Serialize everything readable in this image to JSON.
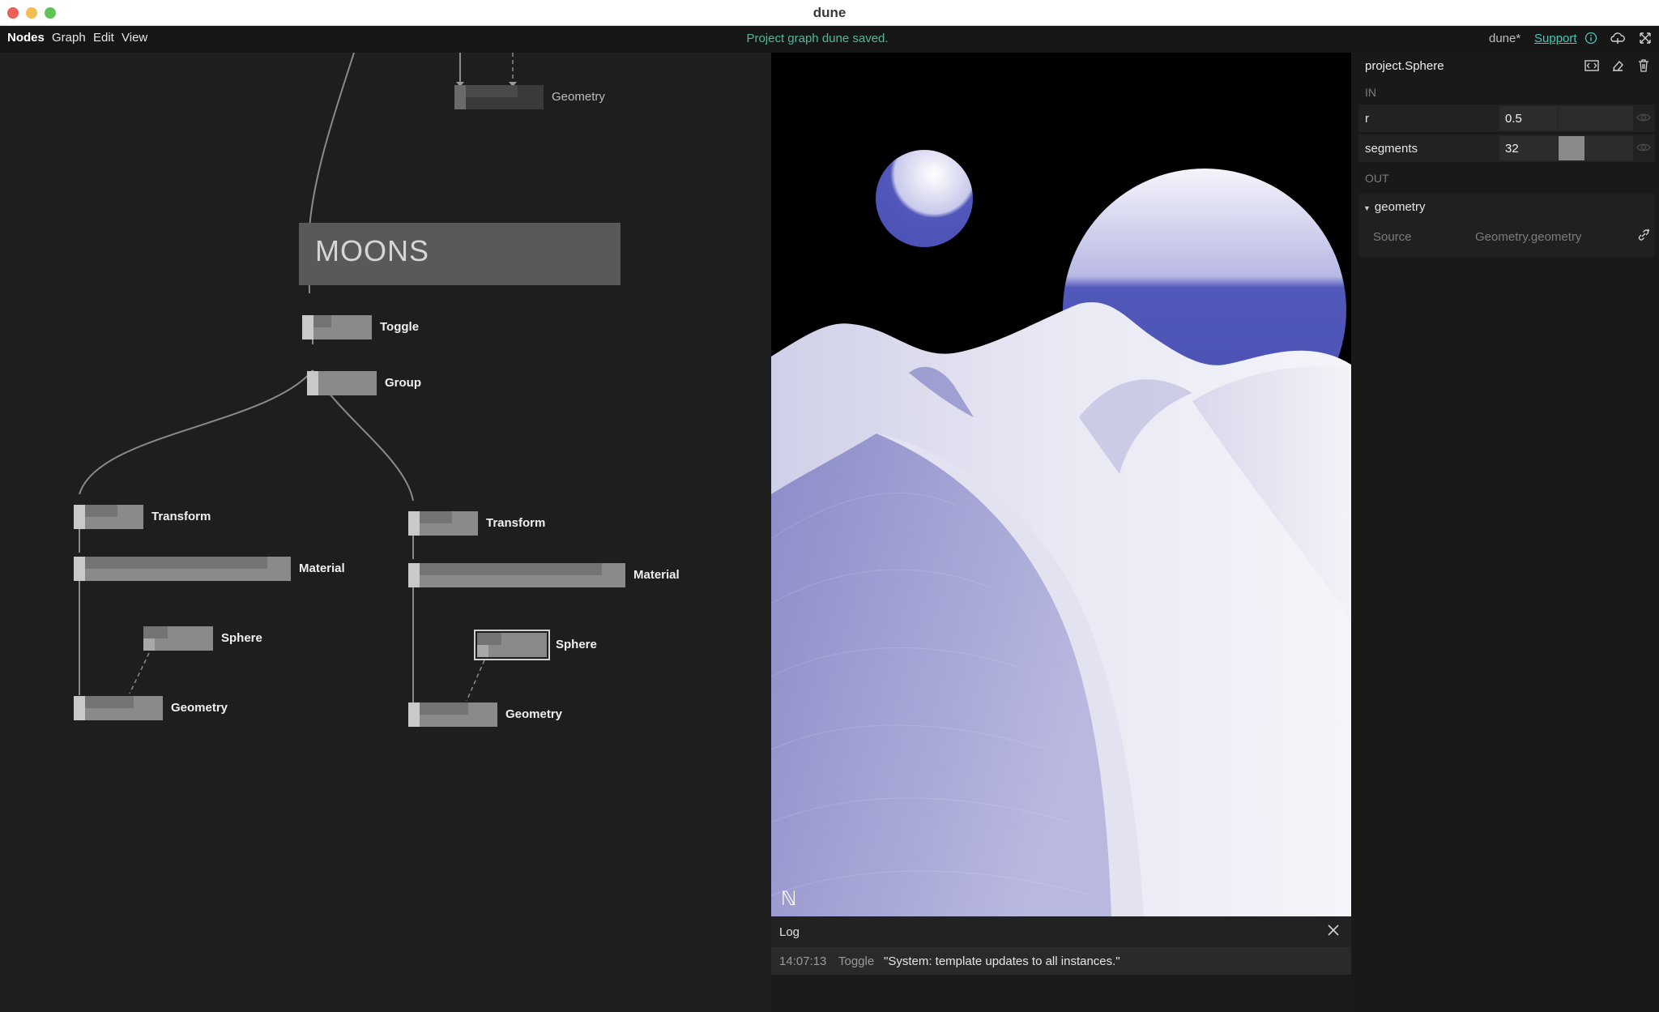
{
  "window": {
    "title": "dune"
  },
  "menu": {
    "items": [
      "Nodes",
      "Graph",
      "Edit",
      "View"
    ],
    "status": "Project graph dune saved.",
    "project_name": "dune*",
    "support_label": "Support",
    "icons": [
      "info-circle-icon",
      "cloud-icon",
      "fullscreen-icon"
    ]
  },
  "graph": {
    "comment": "MOONS",
    "nodes": {
      "geometry_top": "Geometry",
      "toggle": "Toggle",
      "group": "Group",
      "transform_left": "Transform",
      "material_left": "Material",
      "sphere_left": "Sphere",
      "geometry_left": "Geometry",
      "transform_right": "Transform",
      "material_right": "Material",
      "sphere_right": "Sphere",
      "geometry_right": "Geometry"
    }
  },
  "viewport": {
    "logo": "ℕ",
    "colors": {
      "background": "#000000",
      "planet": "#4e55b8",
      "dune_light": "#e8e8f2",
      "dune_shadow": "#8f8fcb"
    }
  },
  "log": {
    "title": "Log",
    "entries": [
      {
        "time": "14:07:13",
        "source": "Toggle",
        "message": "\"System: template updates to all instances.\""
      }
    ]
  },
  "inspector": {
    "title": "project.Sphere",
    "in_label": "IN",
    "out_label": "OUT",
    "params": {
      "r": {
        "label": "r",
        "value": "0.5"
      },
      "segments": {
        "label": "segments",
        "value": "32",
        "slider_fraction": 0.35
      }
    },
    "output": {
      "name": "geometry",
      "source_label": "Source",
      "source_value": "Geometry.geometry"
    },
    "icons": [
      "code-view-icon",
      "eraser-icon",
      "trash-icon",
      "eye-icon",
      "link-icon"
    ]
  }
}
